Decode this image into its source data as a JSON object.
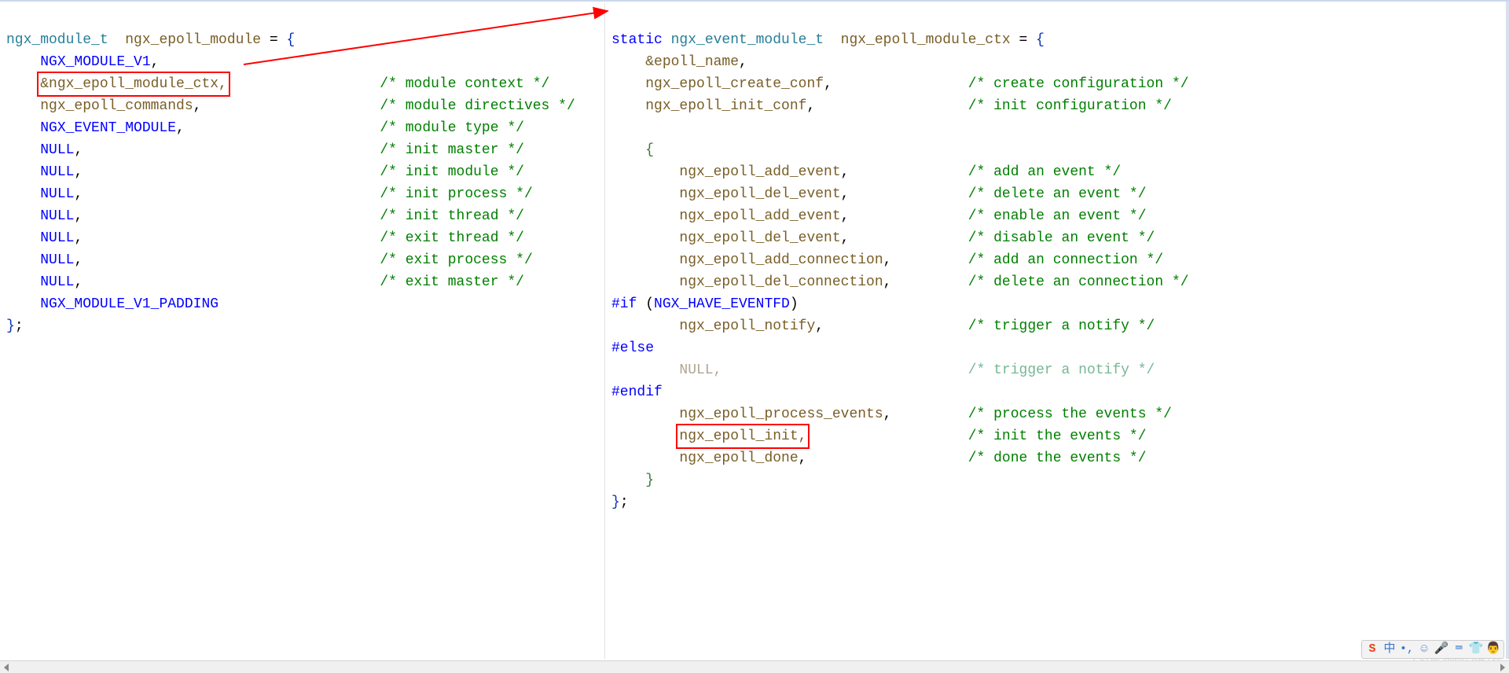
{
  "left": {
    "decl_type": "ngx_module_t",
    "decl_space": "  ",
    "decl_name": "ngx_epoll_module",
    "decl_eq": " = ",
    "brace_open": "{",
    "l1_pad": "    ",
    "l1": "NGX_MODULE_V1",
    "comma": ",",
    "l2": "&ngx_epoll_module_ctx,",
    "c2": "/* module context */",
    "l3": "ngx_epoll_commands",
    "c3": "/* module directives */",
    "l4": "NGX_EVENT_MODULE",
    "c4": "/* module type */",
    "l5": "NULL",
    "c5": "/* init master */",
    "l6c": "/* init module */",
    "l7c": "/* init process */",
    "l8c": "/* init thread */",
    "l9c": "/* exit thread */",
    "l10c": "/* exit process */",
    "l11c": "/* exit master */",
    "l12": "NGX_MODULE_V1_PADDING",
    "brace_close": "}",
    "semi": ";"
  },
  "right": {
    "static": "static",
    "type": " ngx_event_module_t  ",
    "name": "ngx_epoll_module_ctx",
    "eq": " = ",
    "brace_open": "{",
    "r1": "&epoll_name",
    "r2": "ngx_epoll_create_conf",
    "rc2": "/* create configuration */",
    "r3": "ngx_epoll_init_conf",
    "rc3": "/* init configuration */",
    "brace2_open": "{",
    "a1": "ngx_epoll_add_event",
    "ac1": "/* add an event */",
    "a2": "ngx_epoll_del_event",
    "ac2": "/* delete an event */",
    "a3": "ngx_epoll_add_event",
    "ac3": "/* enable an event */",
    "a4": "ngx_epoll_del_event",
    "ac4": "/* disable an event */",
    "a5": "ngx_epoll_add_connection",
    "ac5": "/* add an connection */",
    "a6": "ngx_epoll_del_connection",
    "ac6": "/* delete an connection */",
    "if": "#if",
    "if_cond_open": " (",
    "if_cond": "NGX_HAVE_EVENTFD",
    "if_cond_close": ")",
    "a7": "ngx_epoll_notify",
    "ac7": "/* trigger a notify */",
    "else": "#else",
    "a8": "NULL",
    "ac8": "/* trigger a notify */",
    "endif": "#endif",
    "a9": "ngx_epoll_process_events",
    "ac9": "/* process the events */",
    "a10": "ngx_epoll_init,",
    "ac10": "/* init the events */",
    "a11": "ngx_epoll_done",
    "ac11": "/* done the events */",
    "brace2_close": "}",
    "brace_close": "}",
    "semi": ";"
  },
  "watermark": "CSDN @dai1396734",
  "toolbar": {
    "t1": "S",
    "t2": "中",
    "t3": "•,",
    "t4": "☺",
    "t5": "🎤",
    "t6": "⌨",
    "t7": "👕",
    "t8": "👨"
  }
}
